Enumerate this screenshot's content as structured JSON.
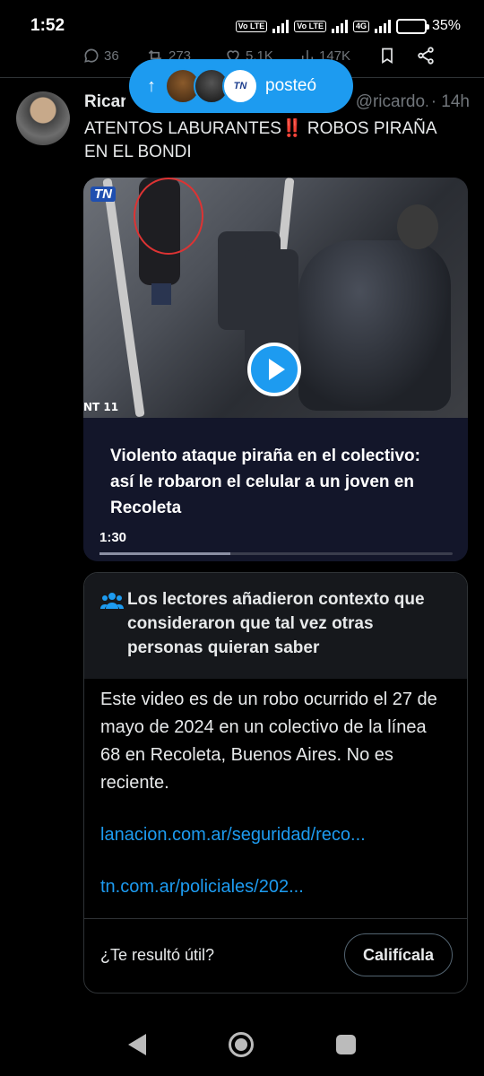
{
  "status_bar": {
    "time": "1:52",
    "network": "4G",
    "volte_1": "Vo LTE",
    "volte_2": "Vo LTE",
    "battery": "35%",
    "battery_level": 0.35,
    "battery_color": "#f5a623"
  },
  "prev_actions": {
    "comments": "36",
    "retweets": "273",
    "likes": "5,1K",
    "views": "147K"
  },
  "posted_pill": {
    "label": "posteó",
    "avatar3_text": "TN",
    "color": "#1d9bf0"
  },
  "tweet": {
    "author": "Ricardo",
    "handle": "@ricardo...",
    "time": "· 14h",
    "text_part1": "ATENTOS LABURANTES",
    "emoji": "‼️",
    "text_part2": " ROBOS PIRAÑA EN EL BONDI"
  },
  "video": {
    "logo": "TN",
    "channel_label": "NT 11",
    "caption": "Violento ataque piraña en el colectivo: así le robaron el celular a un joven en Recoleta",
    "duration": "1:30",
    "progress": 0.37
  },
  "community_note": {
    "title": "Los lectores añadieron contexto que consideraron que tal vez otras personas quieran saber",
    "body": "Este video es de un robo ocurrido el 27 de mayo de 2024 en un colectivo de la línea 68 en Recoleta, Buenos Aires. No es reciente.",
    "link1": "lanacion.com.ar/seguridad/reco...",
    "link2": "tn.com.ar/policiales/202...",
    "helpful_question": "¿Te resultó útil?",
    "rate_button": "Califícala",
    "link_color": "#1d9bf0"
  }
}
